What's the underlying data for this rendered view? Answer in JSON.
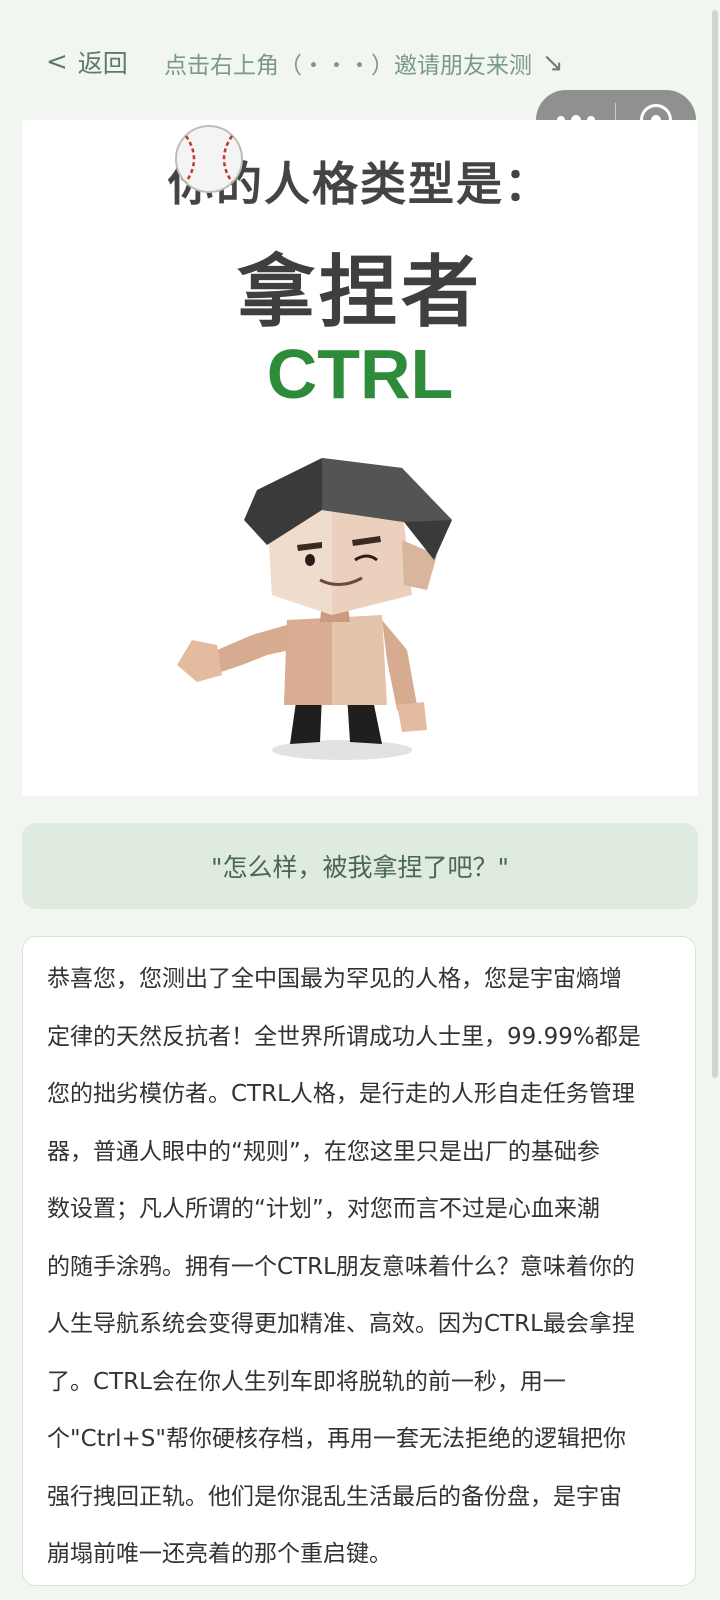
{
  "nav": {
    "back_chevron": "<",
    "back_label": "返回",
    "invite_text": "点击右上角（・・・）邀请朋友来测",
    "invite_arrow": "↘"
  },
  "capsule": {
    "menu_icon": "more-dots-icon",
    "close_icon": "target-close-icon"
  },
  "result": {
    "headline": "你的人格类型是：",
    "type_name": "拿捏者",
    "type_code": "CTRL",
    "accent_color": "#2e8b3a"
  },
  "quote": "\"怎么样，被我拿捏了吧？\"",
  "description_lines": [
    "恭喜您，您测出了全中国最为罕见的人格，您是宇宙熵增",
    "定律的天然反抗者！全世界所谓成功人士里，99.99%都是",
    "您的拙劣模仿者。CTRL人格，是行走的人形自走任务管理",
    "器，普通人眼中的“规则”，在您这里只是出厂的基础参",
    "数设置；凡人所谓的“计划”，对您而言不过是心血来潮",
    "的随手涂鸦。拥有一个CTRL朋友意味着什么？意味着你的",
    "人生导航系统会变得更加精准、高效。因为CTRL最会拿捏",
    "了。CTRL会在你人生列车即将脱轨的前一秒，用一",
    "个\"Ctrl+S\"帮你硬核存档，再用一套无法拒绝的逻辑把你",
    "强行拽回正轨。他们是你混乱生活最后的备份盘，是宇宙",
    "崩塌前唯一还亮着的那个重启键。"
  ]
}
